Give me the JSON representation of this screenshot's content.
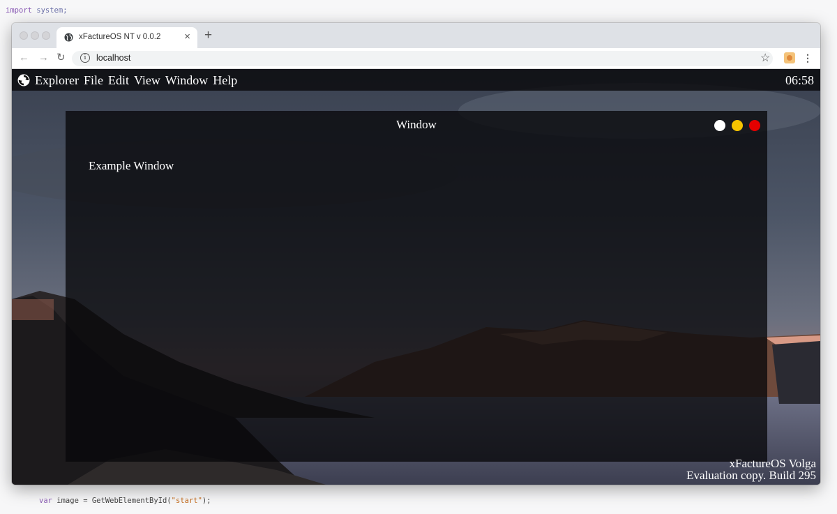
{
  "editor": {
    "top_line_keyword": "import",
    "top_line_rest": " system;",
    "bottom_line_kw": "var",
    "bottom_line_mid": " image = GetWebElementById(",
    "bottom_line_str": "\"start\"",
    "bottom_line_end": ");"
  },
  "browser": {
    "tab_title": "xFactureOS NT v 0.0.2",
    "tab_close": "×",
    "new_tab": "+",
    "url": "localhost",
    "back": "←",
    "forward": "→",
    "reload": "↻",
    "star": "☆",
    "menu": "⋮"
  },
  "os": {
    "menu_items": [
      "Explorer",
      "File",
      "Edit",
      "View",
      "Window",
      "Help"
    ],
    "clock": "06:58",
    "window": {
      "title": "Window",
      "content": "Example Window",
      "buttons": [
        {
          "name": "minimize",
          "color": "#ffffff"
        },
        {
          "name": "maximize",
          "color": "#f5c400"
        },
        {
          "name": "close",
          "color": "#e40000"
        }
      ]
    },
    "watermark_line1": "xFactureOS Volga",
    "watermark_line2": "Evaluation copy. Build 295"
  }
}
